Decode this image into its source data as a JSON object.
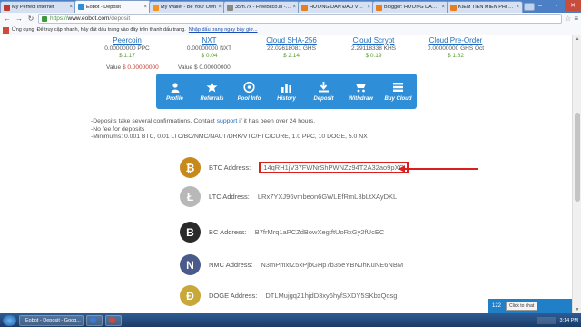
{
  "browser": {
    "tabs": [
      {
        "title": "My Perfect Internet",
        "color": "#c0392b"
      },
      {
        "title": "Eobot - Deposit",
        "color": "#2f8ed8",
        "active": true
      },
      {
        "title": "My Wallet - Be Your Own",
        "color": "#f7931a"
      },
      {
        "title": "35m.7x - FreeBitco.in - ...",
        "color": "#888888"
      },
      {
        "title": "HƯỚNG DẪN ĐÀO VÀNG...",
        "color": "#e67e22"
      },
      {
        "title": "Blogger: HƯỚNG DẪN Đ...",
        "color": "#e67e22"
      },
      {
        "title": "KIẾM TIỀN MIỄN PHÍ TỪ...",
        "color": "#e67e22"
      }
    ],
    "url_scheme": "https://",
    "url_host": "www.eobot.com",
    "url_path": "/deposit",
    "bookmarks": {
      "apps_label": "Ứng dụng",
      "hint": "Để truy cập nhanh, hãy đặt dấu trang vào đây trên thanh dấu trang.",
      "link": "Nhập dấu trang ngay bây giờ..."
    }
  },
  "coins": [
    {
      "name": "Peercoin",
      "amount": "0.00000000 PPC",
      "price": "$ 1.17"
    },
    {
      "name": "NXT",
      "amount": "0.00000000 NXT",
      "price": "$ 0.04"
    },
    {
      "name": "Cloud SHA-256",
      "amount": "22.02618081 GHS",
      "price": "$ 2.14"
    },
    {
      "name": "Cloud Scrypt",
      "amount": "2.29118338 KHS",
      "price": "$ 0.19"
    },
    {
      "name": "Cloud Pre-Order",
      "amount": "0.00000000 GHS Oct",
      "price": "$ 1.82"
    }
  ],
  "values": {
    "label": "Value",
    "v1": "$ 0.00000000",
    "v2": "Value $ 0.00000000"
  },
  "nav": [
    {
      "label": "Profile",
      "icon": "profile-icon"
    },
    {
      "label": "Referrals",
      "icon": "referrals-icon"
    },
    {
      "label": "Pool Info",
      "icon": "pool-info-icon"
    },
    {
      "label": "History",
      "icon": "history-icon"
    },
    {
      "label": "Deposit",
      "icon": "deposit-icon"
    },
    {
      "label": "Withdraw",
      "icon": "withdraw-icon"
    },
    {
      "label": "Buy Cloud",
      "icon": "buy-cloud-icon"
    }
  ],
  "notes": {
    "line1_pre": "-Deposits take several confirmations. Contact ",
    "line1_link": "support",
    "line1_post": " if it has been over 24 hours.",
    "line2": "-No fee for deposits",
    "line3": "-Minimums: 0.001 BTC, 0.01 LTC/BC/NMC/NAUT/DRK/VTC/FTC/CURE, 1.0 PPC, 10 DOGE, 5.0 NXT"
  },
  "addresses": [
    {
      "label": "BTC Address:",
      "address": "14qRH1jV37FWNrShPWNZz94T2A32ao9pXC",
      "color": "#c8891b",
      "glyph": "₿"
    },
    {
      "label": "LTC Address:",
      "address": "LRx7YXJ96vmbeon6GWLEfRmL3bLtXAyDKL",
      "color": "#b8b8b8",
      "glyph": "Ł"
    },
    {
      "label": "BC Address:",
      "address": "B7frMrq1aPCZdBowXegtftUoRxGy2fUcEC",
      "color": "#2a2a2a",
      "glyph": "B"
    },
    {
      "label": "NMC Address:",
      "address": "N3mPmxrZ5xPjbGHp7b35eYBNJhKuNE6NBM",
      "color": "#4a5a8a",
      "glyph": "N"
    },
    {
      "label": "DOGE Address:",
      "address": "DTLMujgqZ1hjdD3xy6hyfSXDY5SKbxQosg",
      "color": "#c9a83a",
      "glyph": "Ð"
    }
  ],
  "chat": {
    "count": "122",
    "tip": "Click to chat"
  },
  "taskbar": {
    "items": [
      {
        "title": "Eobot - Deposit - Goog...",
        "color": "#e6b422"
      },
      {
        "title": "",
        "color": "#3a7bd5"
      },
      {
        "title": "",
        "color": "#d04a3a"
      }
    ],
    "clock": "3:14 PM"
  }
}
